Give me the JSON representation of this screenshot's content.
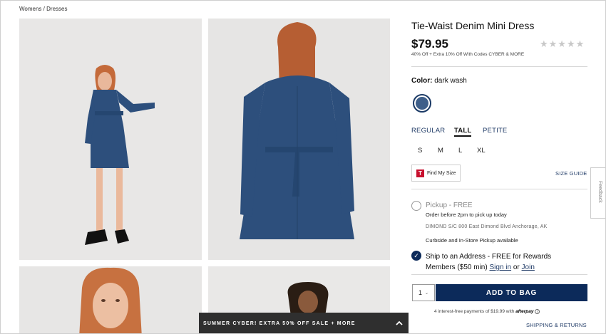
{
  "breadcrumb": {
    "womens": "Womens",
    "separator": "/",
    "dresses": "Dresses"
  },
  "product": {
    "title": "Tie-Waist Denim Mini Dress",
    "price": "$79.95",
    "promo": "40% Off + Extra 10% Off With Codes CYBER & MORE",
    "rating_stars": "★★★★★",
    "rating_value": 0,
    "color_label": "Color:",
    "color_value": "dark wash",
    "swatch_color": "#3e5f8a"
  },
  "fits": [
    {
      "label": "REGULAR",
      "active": false
    },
    {
      "label": "TALL",
      "active": true
    },
    {
      "label": "PETITE",
      "active": false
    }
  ],
  "sizes": [
    "S",
    "M",
    "L",
    "XL"
  ],
  "find_my_size": {
    "icon": "T",
    "label": "Find My Size"
  },
  "size_guide": "SIZE GUIDE",
  "feedback": "Feedback",
  "fulfillment": {
    "pickup_title": "Pickup - FREE",
    "pickup_sub": "Order before 2pm to pick up today",
    "store": "DIMOND S/C 800 East Dimond Blvd  Anchorage, AK",
    "curbside": "Curbside and In-Store Pickup available",
    "ship_text": "Ship to an Address - FREE for Rewards Members ($50 min)",
    "sign_in": "Sign in",
    "or": "or",
    "join": "Join",
    "selected": "ship"
  },
  "cart": {
    "qty": "1",
    "add_to_bag": "ADD TO BAG",
    "afterpay_text": "4 interest-free payments of $19.99 with",
    "afterpay_brand": "afterpay",
    "shipping_returns": "SHIPPING & RETURNS"
  },
  "banner": {
    "text": "SUMMER CYBER! EXTRA 50% OFF SALE + MORE"
  },
  "colors": {
    "navy": "#0c2a5a",
    "link": "#1f3a66",
    "banner_bg": "#2f2f2f",
    "brand_red": "#c8102e"
  }
}
